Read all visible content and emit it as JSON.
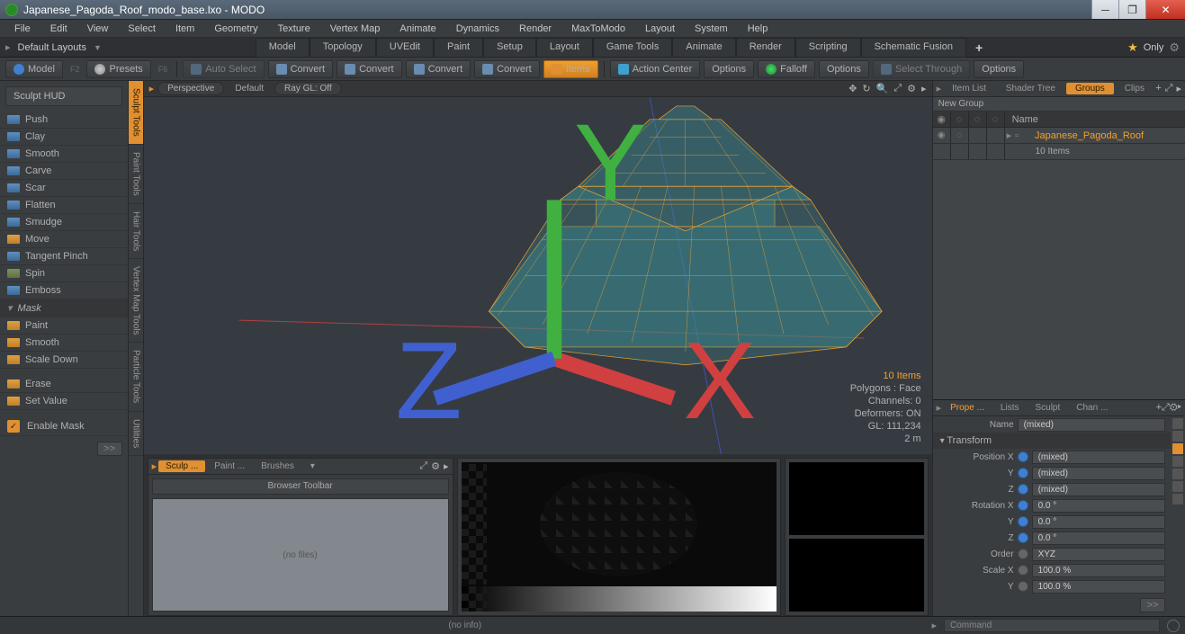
{
  "window": {
    "title": "Japanese_Pagoda_Roof_modo_base.lxo - MODO"
  },
  "menu": [
    "File",
    "Edit",
    "View",
    "Select",
    "Item",
    "Geometry",
    "Texture",
    "Vertex Map",
    "Animate",
    "Dynamics",
    "Render",
    "MaxToModo",
    "Layout",
    "System",
    "Help"
  ],
  "layouts": {
    "label": "Default Layouts",
    "tabs": [
      "Model",
      "Topology",
      "UVEdit",
      "Paint",
      "Setup",
      "Layout",
      "Game Tools",
      "Animate",
      "Render",
      "Scripting",
      "Schematic Fusion"
    ],
    "only": "Only"
  },
  "toolbar": {
    "model": "Model",
    "f2": "F2",
    "presets": "Presets",
    "f6": "F6",
    "autosel": "Auto Select",
    "convert": "Convert",
    "items": "Items",
    "action": "Action Center",
    "options": "Options",
    "falloff": "Falloff",
    "seltrough": "Select Through"
  },
  "sculpthud": "Sculpt HUD",
  "sculpt_tools": [
    "Push",
    "Clay",
    "Smooth",
    "Carve",
    "Scar",
    "Flatten",
    "Smudge",
    "Move",
    "Tangent Pinch",
    "Spin",
    "Emboss"
  ],
  "mask_hdr": "Mask",
  "mask_tools": [
    "Paint",
    "Smooth",
    "Scale Down"
  ],
  "mask_tools2": [
    "Erase",
    "Set Value"
  ],
  "enable_mask": "Enable Mask",
  "verttabs": [
    "Sculpt Tools",
    "Paint Tools",
    "Hair Tools",
    "Vertex Map Tools",
    "Particle Tools",
    "Utilities"
  ],
  "viewport": {
    "persp": "Perspective",
    "default": "Default",
    "raygl": "Ray GL: Off"
  },
  "vpstats": {
    "items": "10 Items",
    "polys": "Polygons : Face",
    "channels": "Channels: 0",
    "deformers": "Deformers: ON",
    "gl": "GL: 111,234",
    "dist": "2 m"
  },
  "bottomtabs": {
    "sculp": "Sculp ...",
    "paint": "Paint ...",
    "brushes": "Brushes",
    "browser": "Browser Toolbar",
    "nofiles": "(no files)"
  },
  "right": {
    "tabs": [
      "Item List",
      "Shader Tree",
      "Groups",
      "Clips"
    ],
    "newgroup": "New Group",
    "namehdr": "Name",
    "groupname": "Japanese_Pagoda_Roof",
    "groupcount": "10 Items"
  },
  "props": {
    "tabs": [
      "Prope ...",
      "Lists",
      "Sculpt",
      "Chan ..."
    ],
    "name_label": "Name",
    "name_val": "(mixed)",
    "transform": "Transform",
    "posx": "Position X",
    "y": "Y",
    "z": "Z",
    "mixed": "(mixed)",
    "rotx": "Rotation X",
    "deg": "0.0 °",
    "order": "Order",
    "xyz": "XYZ",
    "scalex": "Scale X",
    "pct": "100.0 %"
  },
  "bottom": {
    "noinfo": "(no info)",
    "command": "Command"
  }
}
